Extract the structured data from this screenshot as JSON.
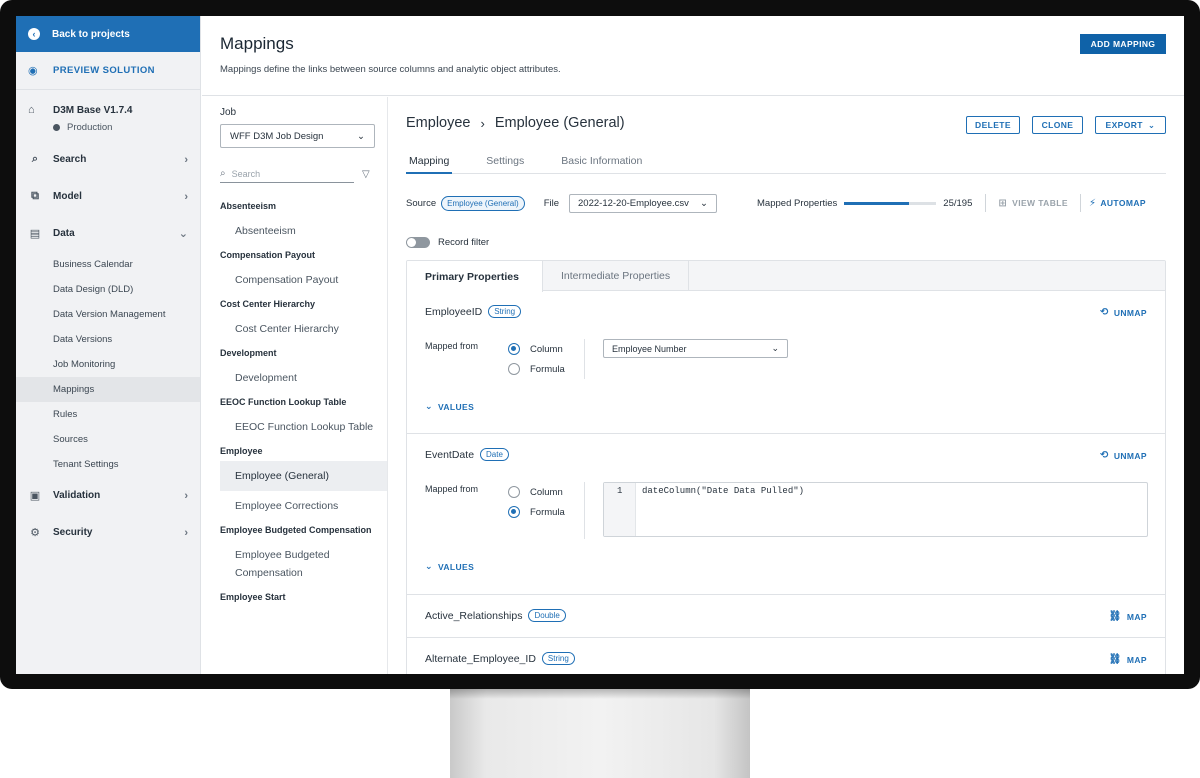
{
  "sidebar": {
    "back_label": "Back to projects",
    "preview_label": "PREVIEW SOLUTION",
    "solution_name": "D3M Base V1.7.4",
    "environment": "Production",
    "nav": {
      "search": "Search",
      "model": "Model",
      "data": "Data",
      "validation": "Validation",
      "security": "Security"
    },
    "data_items": [
      "Business Calendar",
      "Data Design (DLD)",
      "Data Version Management",
      "Data Versions",
      "Job Monitoring",
      "Mappings",
      "Rules",
      "Sources",
      "Tenant Settings"
    ],
    "active_item": "Mappings"
  },
  "header": {
    "title": "Mappings",
    "description": "Mappings define the links between source columns and analytic object attributes.",
    "add_button": "ADD MAPPING"
  },
  "job": {
    "label": "Job",
    "selected": "WFF D3M Job Design",
    "search_placeholder": "Search",
    "groups": [
      {
        "name": "Absenteeism",
        "items": [
          "Absenteeism"
        ]
      },
      {
        "name": "Compensation Payout",
        "items": [
          "Compensation Payout"
        ]
      },
      {
        "name": "Cost Center Hierarchy",
        "items": [
          "Cost Center Hierarchy"
        ]
      },
      {
        "name": "Development",
        "items": [
          "Development"
        ]
      },
      {
        "name": "EEOC Function Lookup Table",
        "items": [
          "EEOC Function Lookup Table"
        ]
      },
      {
        "name": "Employee",
        "items": [
          "Employee (General)",
          "Employee Corrections"
        ]
      },
      {
        "name": "Employee Budgeted Compensation",
        "items": [
          "Employee Budgeted Compensation"
        ]
      },
      {
        "name": "Employee Start",
        "items": []
      }
    ],
    "active_mapping": "Employee (General)"
  },
  "detail": {
    "crumb_parent": "Employee",
    "crumb_separator": "›",
    "crumb_current": "Employee (General)",
    "delete": "DELETE",
    "clone": "CLONE",
    "export": "EXPORT",
    "tabs": [
      "Mapping",
      "Settings",
      "Basic Information"
    ],
    "source_label": "Source",
    "source_value": "Employee (General)",
    "file_label": "File",
    "file_value": "2022-12-20-Employee.csv",
    "mapped_label": "Mapped Properties",
    "mapped_count": "25/195",
    "mapped_fraction": 0.7,
    "view_table": "VIEW TABLE",
    "automap": "AUTOMAP",
    "record_filter": "Record filter",
    "card_tabs": [
      "Primary Properties",
      "Intermediate Properties"
    ],
    "mapped_from": "Mapped from",
    "column_opt": "Column",
    "formula_opt": "Formula",
    "unmap": "UNMAP",
    "map": "MAP",
    "values": "VALUES",
    "properties": [
      {
        "name": "EmployeeID",
        "type": "String",
        "mode": "column",
        "column": "Employee Number"
      },
      {
        "name": "EventDate",
        "type": "Date",
        "mode": "formula",
        "line": "1",
        "formula": "dateColumn(\"Date Data Pulled\")"
      },
      {
        "name": "Active_Relationships",
        "type": "Double"
      },
      {
        "name": "Alternate_Employee_ID",
        "type": "String"
      }
    ]
  },
  "colors": {
    "accent": "#1f6fb5",
    "back_button": "#1f6fb5",
    "add_button": "#0f62a8",
    "sidebar_bg": "#f1f2f4"
  }
}
